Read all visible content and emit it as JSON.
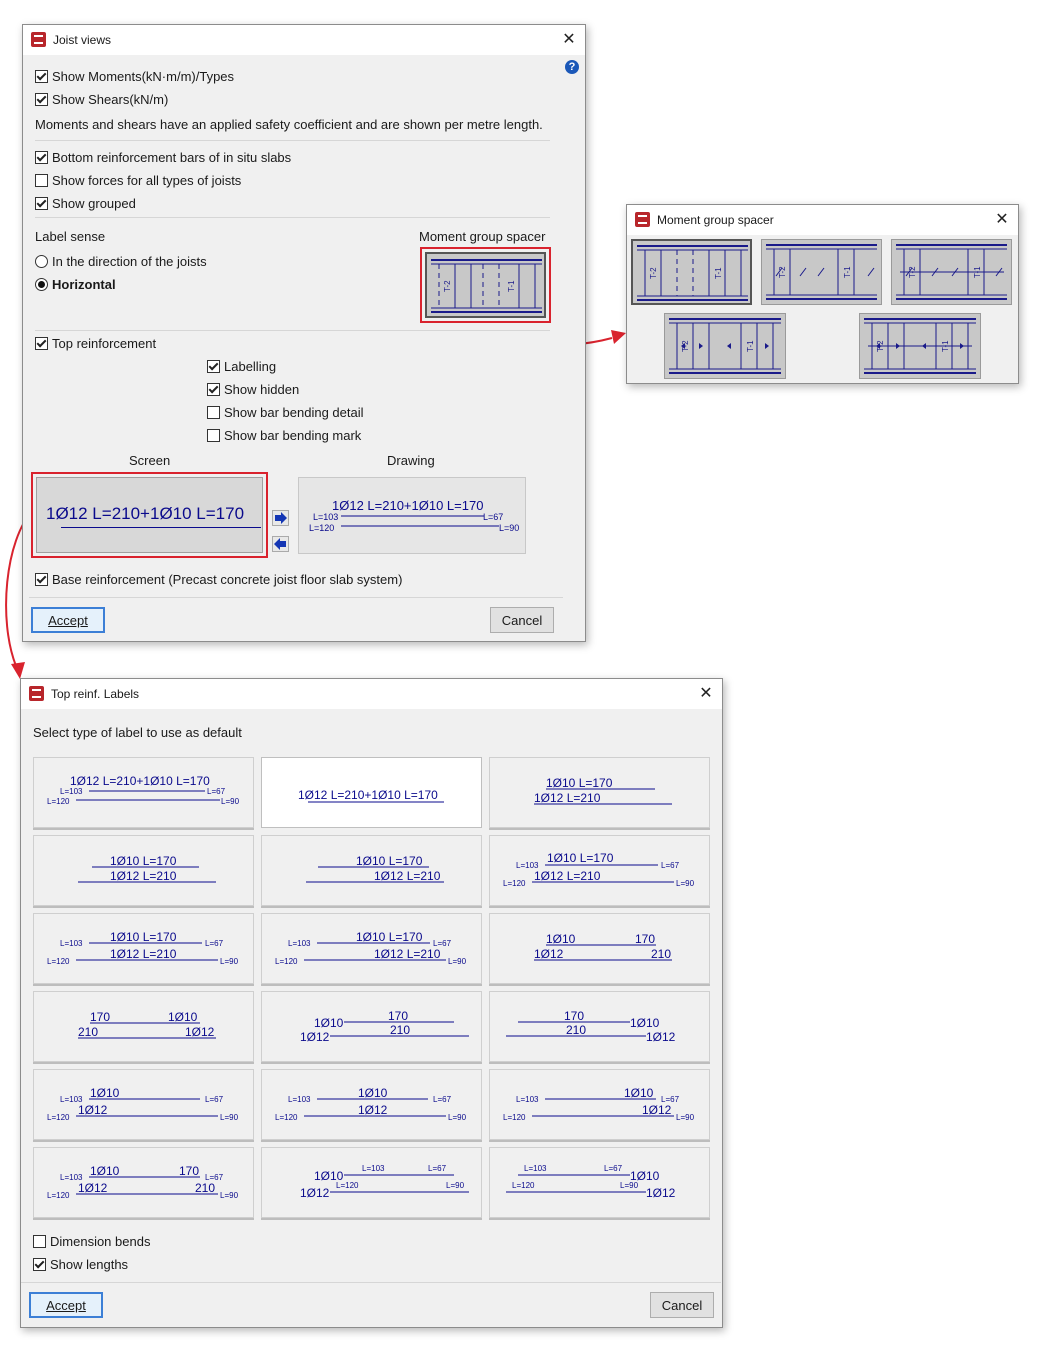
{
  "joist": {
    "title": "Joist views",
    "close": "✕",
    "show_moments": "Show Moments(kN·m/m)/Types",
    "show_shears": "Show Shears(kN/m)",
    "note": "Moments and shears have an applied safety coefficient and are shown per metre length.",
    "bottom_bars": "Bottom reinforcement bars of in situ slabs",
    "show_forces": "Show forces for all types of joists",
    "show_grouped": "Show grouped",
    "label_sense": "Label sense",
    "direction": "In the direction of the joists",
    "horizontal": "Horizontal",
    "moment_spacer_label": "Moment group spacer",
    "top_reinf": "Top reinforcement",
    "labelling": "Labelling",
    "show_hidden": "Show hidden",
    "bending_detail": "Show bar bending detail",
    "bending_mark": "Show bar bending mark",
    "screen": "Screen",
    "drawing": "Drawing",
    "screen_label": "1Ø12 L=210+1Ø10 L=170",
    "drawing_label": "1Ø12 L=210+1Ø10 L=170",
    "l103": "L=103",
    "l120": "L=120",
    "l67": "L=67",
    "l90": "L=90",
    "base_reinf": "Base reinforcement (Precast concrete joist floor slab system)",
    "accept": "Accept",
    "cancel": "Cancel"
  },
  "spacer": {
    "title": "Moment group spacer",
    "close": "✕",
    "t1": "T-1",
    "t2": "T-2"
  },
  "labels": {
    "title": "Top reinf. Labels",
    "close": "✕",
    "select": "Select type of label to use as default",
    "dimension_bends": "Dimension bends",
    "show_lengths": "Show lengths",
    "accept": "Accept",
    "cancel": "Cancel",
    "t_full": "1Ø12 L=210+1Ø10 L=170",
    "t_1010": "1Ø10 L=170",
    "t_1012": "1Ø12 L=210",
    "b10": "1Ø10",
    "b12": "1Ø12",
    "n170": "170",
    "n210": "210",
    "l103": "L=103",
    "l120": "L=120",
    "l67": "L=67",
    "l90": "L=90"
  },
  "colors": {
    "accent_red": "#d9232e",
    "label_blue": "#0a0a8c",
    "bar_blue": "#1a1a8a"
  }
}
